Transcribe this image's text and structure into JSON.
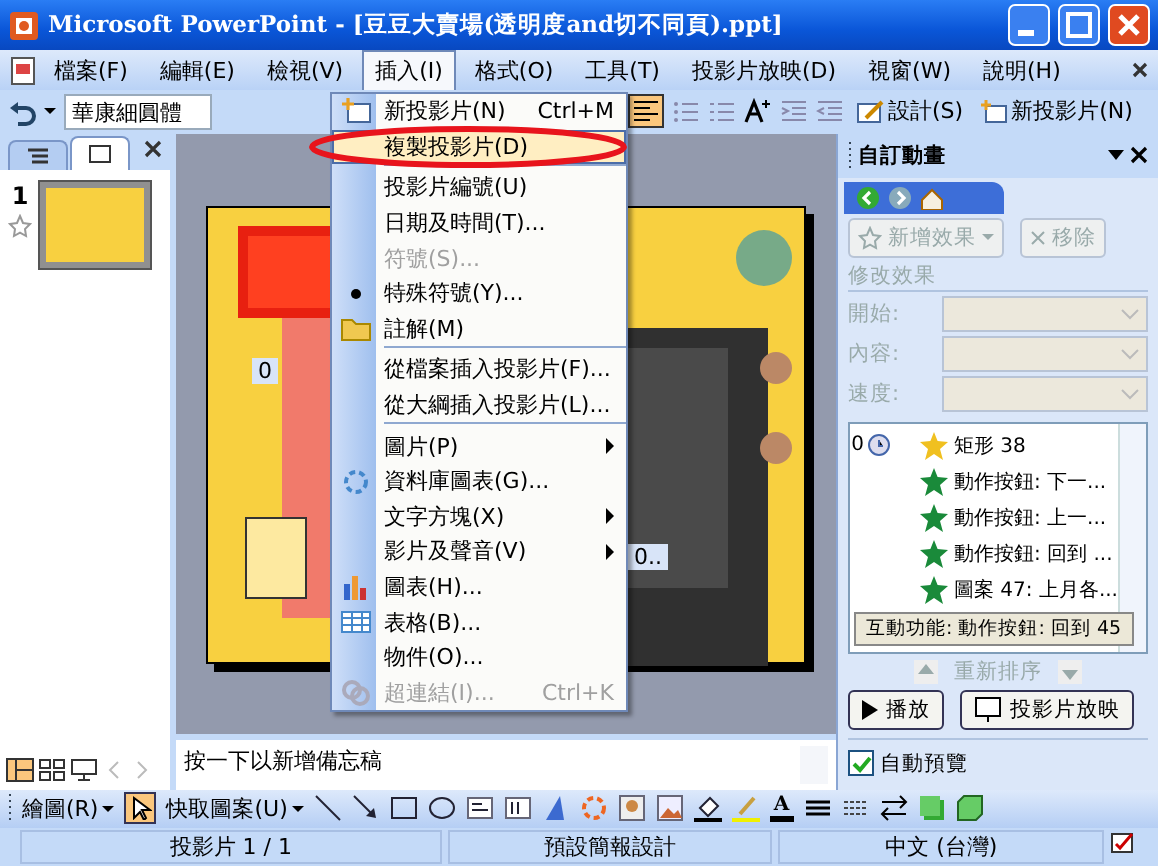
{
  "window": {
    "title": "Microsoft PowerPoint - [豆豆大賣場(透明度and切不同頁).ppt]"
  },
  "menu_bar": {
    "items": [
      {
        "label": "檔案(F)",
        "selected": false
      },
      {
        "label": "編輯(E)",
        "selected": false
      },
      {
        "label": "檢視(V)",
        "selected": false
      },
      {
        "label": "插入(I)",
        "selected": true
      },
      {
        "label": "格式(O)",
        "selected": false
      },
      {
        "label": "工具(T)",
        "selected": false
      },
      {
        "label": "投影片放映(D)",
        "selected": false
      },
      {
        "label": "視窗(W)",
        "selected": false
      },
      {
        "label": "說明(H)",
        "selected": false
      }
    ]
  },
  "toolbar": {
    "font": "華康細圓體",
    "buttons": [
      {
        "label": "設計(S)"
      },
      {
        "label": "新投影片(N)"
      }
    ]
  },
  "insert_menu": {
    "items": [
      {
        "kind": "item",
        "label": "新投影片(N)",
        "shortcut": "Ctrl+M",
        "disabled": false,
        "highlighted": false,
        "submenu": false
      },
      {
        "kind": "item",
        "label": "複製投影片(D)",
        "disabled": false,
        "highlighted": true,
        "submenu": false
      },
      {
        "kind": "separator"
      },
      {
        "kind": "item",
        "label": "投影片編號(U)",
        "disabled": false,
        "highlighted": false,
        "submenu": false
      },
      {
        "kind": "item",
        "label": "日期及時間(T)...",
        "disabled": false,
        "highlighted": false,
        "submenu": false
      },
      {
        "kind": "item",
        "label": "符號(S)...",
        "disabled": true,
        "highlighted": false,
        "submenu": false
      },
      {
        "kind": "item",
        "label": "特殊符號(Y)...",
        "disabled": false,
        "highlighted": false,
        "submenu": false
      },
      {
        "kind": "item",
        "label": "註解(M)",
        "disabled": false,
        "highlighted": false,
        "submenu": false
      },
      {
        "kind": "separator"
      },
      {
        "kind": "item",
        "label": "從檔案插入投影片(F)...",
        "disabled": false,
        "highlighted": false,
        "submenu": false
      },
      {
        "kind": "item",
        "label": "從大綱插入投影片(L)...",
        "disabled": false,
        "highlighted": false,
        "submenu": false
      },
      {
        "kind": "separator"
      },
      {
        "kind": "item",
        "label": "圖片(P)",
        "disabled": false,
        "highlighted": false,
        "submenu": true
      },
      {
        "kind": "item",
        "label": "資料庫圖表(G)...",
        "disabled": false,
        "highlighted": false,
        "submenu": false
      },
      {
        "kind": "item",
        "label": "文字方塊(X)",
        "disabled": false,
        "highlighted": false,
        "submenu": true
      },
      {
        "kind": "item",
        "label": "影片及聲音(V)",
        "disabled": false,
        "highlighted": false,
        "submenu": true
      },
      {
        "kind": "item",
        "label": "圖表(H)...",
        "disabled": false,
        "highlighted": false,
        "submenu": false
      },
      {
        "kind": "item",
        "label": "表格(B)...",
        "disabled": false,
        "highlighted": false,
        "submenu": false
      },
      {
        "kind": "item",
        "label": "物件(O)...",
        "disabled": false,
        "highlighted": false,
        "submenu": false
      },
      {
        "kind": "item",
        "label": "超連結(I)...",
        "shortcut": "Ctrl+K",
        "disabled": true,
        "highlighted": false,
        "submenu": false
      }
    ]
  },
  "left_pane": {
    "tabs": [
      {
        "kind": "outline",
        "selected": false
      },
      {
        "kind": "slides",
        "selected": true
      }
    ],
    "slide_number": "1"
  },
  "slide": {
    "labels": [
      "0",
      "0.."
    ]
  },
  "task_pane": {
    "title": "自訂動畫",
    "add_effect": "新增效果",
    "remove": "移除",
    "section": "修改效果",
    "fields": [
      {
        "label": "開始:"
      },
      {
        "label": "內容:"
      },
      {
        "label": "速度:"
      }
    ],
    "effects": [
      {
        "order": "0",
        "name": "矩形 38",
        "color": "#f0c020"
      },
      {
        "name": "動作按鈕: 下一...",
        "color": "#1a8a3a"
      },
      {
        "name": "動作按鈕: 上一...",
        "color": "#1a8a3a"
      },
      {
        "name": "動作按鈕: 回到 ...",
        "color": "#1a8a3a"
      },
      {
        "name": "圖案 47: 上月各...",
        "color": "#1a8a3a"
      }
    ],
    "trigger_tooltip": "互動功能: 動作按鈕: 回到 45",
    "reorder": "重新排序",
    "play": "播放",
    "slideshow": "投影片放映",
    "auto_preview": {
      "label": "自動預覽",
      "checked": true
    }
  },
  "notes": {
    "placeholder": "按一下以新增備忘稿"
  },
  "drawing_toolbar": {
    "draw": "繪圖(R)",
    "autoshapes": "快取圖案(U)",
    "font_color_glyph": "A"
  },
  "status_bar": [
    "投影片 1 / 1",
    "預設簡報設計",
    "中文 (台灣)"
  ]
}
